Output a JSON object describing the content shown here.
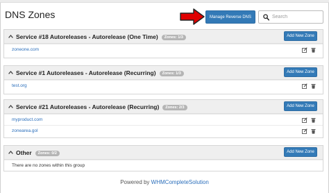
{
  "header": {
    "title": "DNS Zones",
    "reverse_dns_label": "Manage Reverse DNS",
    "search_placeholder": "Search"
  },
  "colors": {
    "primary_button": "#337ab7",
    "link": "#2a6ebb",
    "badge": "#b5b5b5",
    "arrow": "#e00000"
  },
  "services": [
    {
      "title": "Service #18 Autoreleases - Autorelease (One Time)",
      "badge": "Zones: 1/3",
      "add_label": "Add New Zone",
      "zones": [
        "zoneone.com"
      ]
    },
    {
      "title": "Service #1 Autoreleases - Autorelease (Recurring)",
      "badge": "Zones: 1/3",
      "add_label": "Add New Zone",
      "zones": [
        "test.org"
      ]
    },
    {
      "title": "Service #21 Autoreleases - Autorelease (Recurring)",
      "badge": "Zones: 2/3",
      "add_label": "Add New Zone",
      "zones": [
        "myproduct.com",
        "zonearea.gol"
      ]
    },
    {
      "title": "Other",
      "badge": "Zones: 0/2",
      "add_label": "Add New Zone",
      "empty_message": "There are no zones within this group"
    }
  ],
  "footer": {
    "powered_by": "Powered by",
    "link_text": "WHMCompleteSolution"
  }
}
